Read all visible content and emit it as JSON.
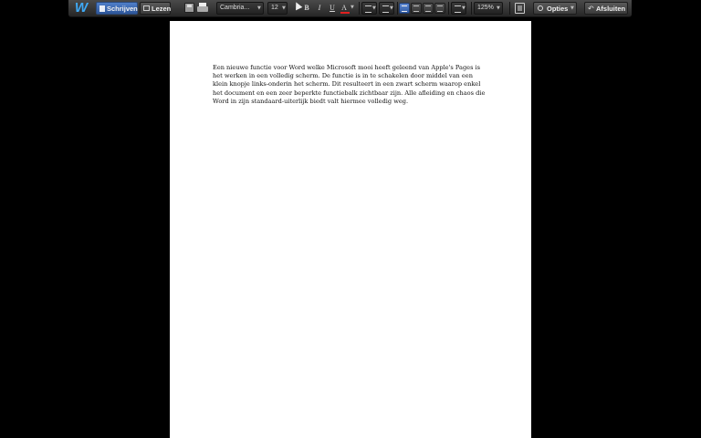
{
  "toolbar": {
    "logo": "W",
    "mode_write": "Schrijven",
    "mode_read": "Lezen",
    "font_name": "Cambria...",
    "font_size": "12",
    "bold": "B",
    "italic": "I",
    "underline": "U",
    "text_color_letter": "A",
    "text_color": "#e02020",
    "zoom": "125%",
    "options_label": "Opties",
    "close_label": "Afsluiten",
    "accent": "#3b6fc4"
  },
  "document": {
    "text": "Een nieuwe functie voor Word welke Microsoft mooi heeft geleend van Apple's Pages is het werken in een volledig scherm. De functie is in te schakelen door middel van een klein knopje links-onderin het scherm. Dit resulteert in een zwart scherm waarop enkel het document en een zeer beperkte functiebalk zichtbaar zijn. Alle afleiding en chaos die Word in zijn standaard-uiterlijk biedt valt hiermee volledig weg."
  }
}
